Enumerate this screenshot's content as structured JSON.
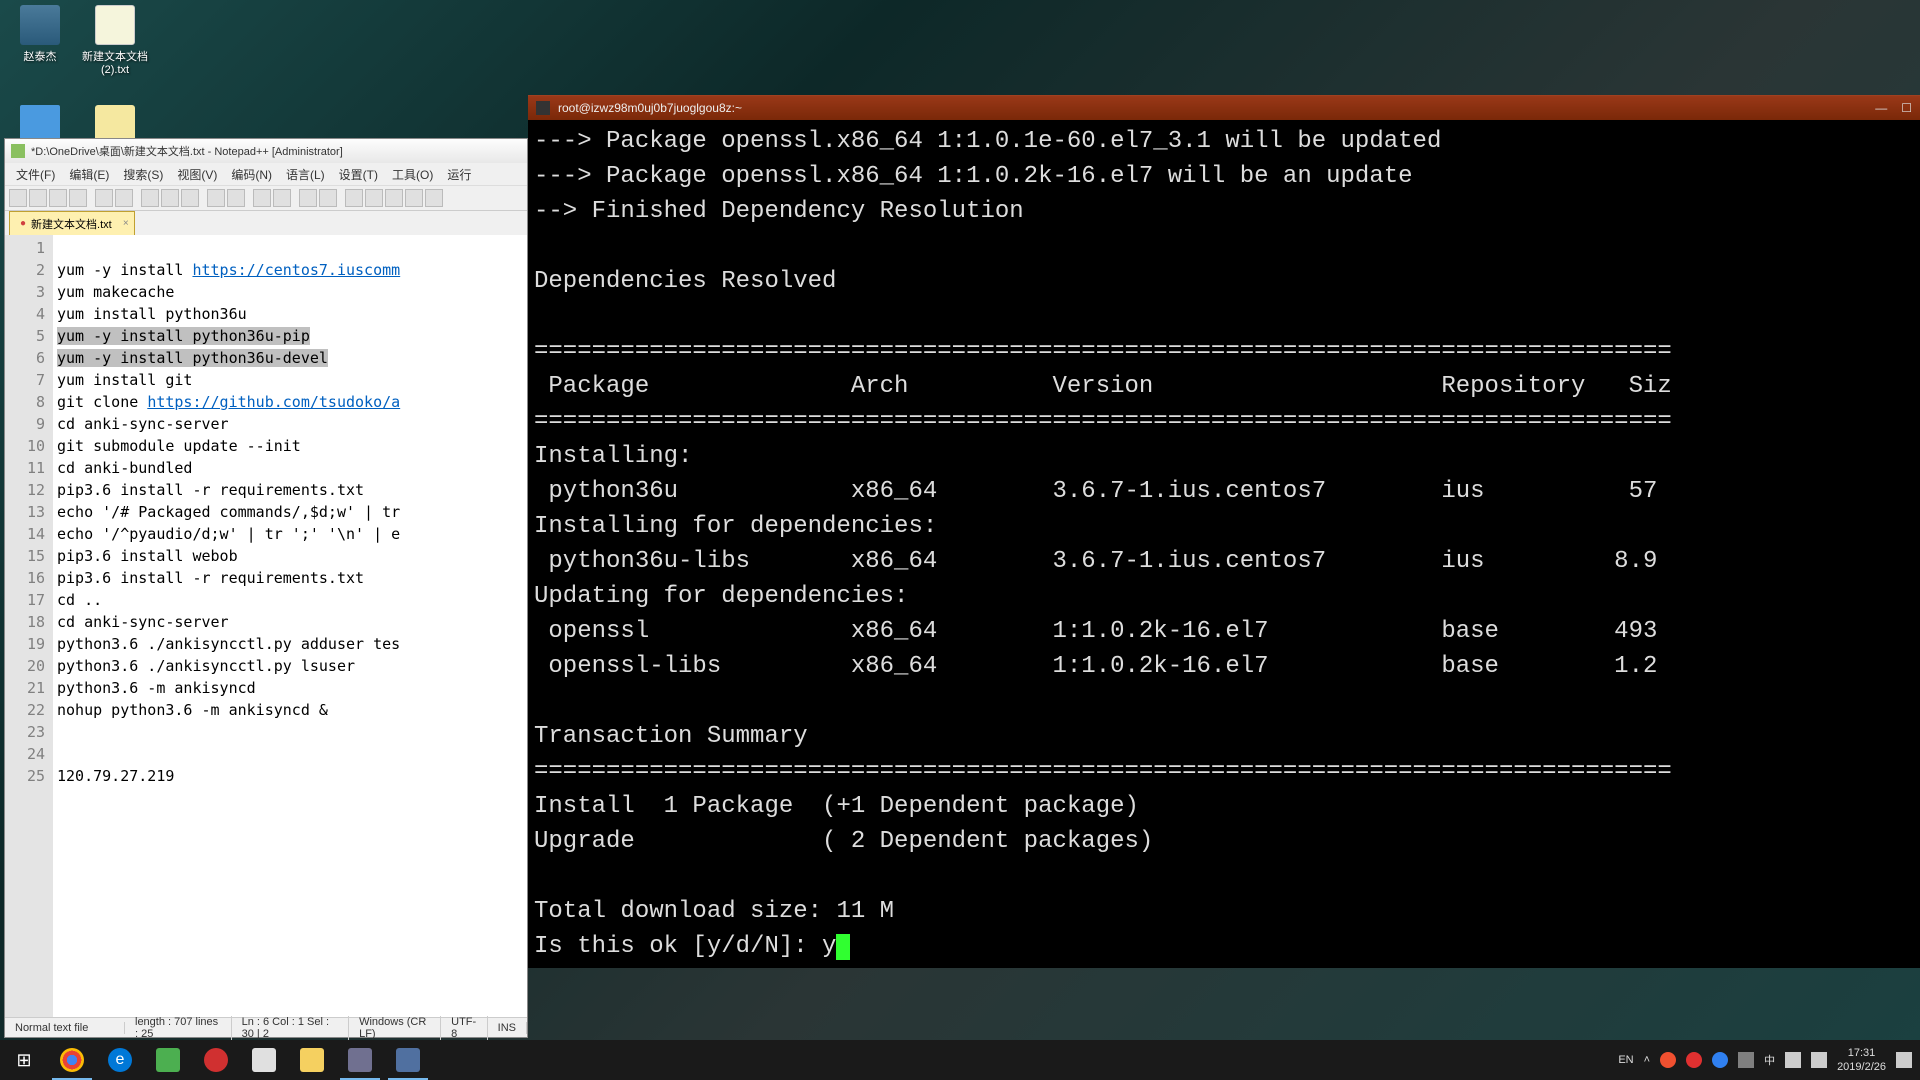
{
  "desktop": {
    "icons": [
      {
        "label": "赵泰杰"
      },
      {
        "label": "新建文本文档 (2).txt"
      },
      {
        "label": ""
      },
      {
        "label": ""
      }
    ]
  },
  "notepadpp": {
    "title": "*D:\\OneDrive\\桌面\\新建文本文档.txt - Notepad++ [Administrator]",
    "menu": [
      "文件(F)",
      "编辑(E)",
      "搜索(S)",
      "视图(V)",
      "编码(N)",
      "语言(L)",
      "设置(T)",
      "工具(O)",
      "运行"
    ],
    "tab": "新建文本文档.txt",
    "lines": [
      "",
      "yum -y install https://centos7.iuscomm",
      "yum makecache",
      "yum install python36u",
      "yum -y install python36u-pip",
      "yum -y install python36u-devel",
      "yum install git",
      "git clone https://github.com/tsudoko/a",
      "cd anki-sync-server",
      "git submodule update --init",
      "cd anki-bundled",
      "pip3.6 install -r requirements.txt",
      "echo '/# Packaged commands/,$d;w' | tr",
      "echo '/^pyaudio/d;w' | tr ';' '\\n' | e",
      "pip3.6 install webob",
      "pip3.6 install -r requirements.txt",
      "cd ..",
      "cd anki-sync-server",
      "python3.6 ./ankisyncctl.py adduser tes",
      "python3.6 ./ankisyncctl.py lsuser",
      "python3.6 -m ankisyncd",
      "nohup python3.6 -m ankisyncd &",
      "",
      "",
      "120.79.27.219"
    ],
    "status": {
      "type": "Normal text file",
      "length": "length : 707    lines : 25",
      "pos": "Ln : 6    Col : 1    Sel : 30 | 2",
      "eol": "Windows (CR LF)",
      "enc": "UTF-8",
      "ins": "INS"
    }
  },
  "terminal": {
    "title": "root@izwz98m0uj0b7juoglgou8z:~",
    "lines": [
      "---> Package openssl.x86_64 1:1.0.1e-60.el7_3.1 will be updated",
      "---> Package openssl.x86_64 1:1.0.2k-16.el7 will be an update",
      "--> Finished Dependency Resolution",
      "",
      "Dependencies Resolved",
      "",
      "===============================================================================",
      " Package              Arch          Version                    Repository   Siz",
      "===============================================================================",
      "Installing:",
      " python36u            x86_64        3.6.7-1.ius.centos7        ius          57",
      "Installing for dependencies:",
      " python36u-libs       x86_64        3.6.7-1.ius.centos7        ius         8.9",
      "Updating for dependencies:",
      " openssl              x86_64        1:1.0.2k-16.el7            base        493",
      " openssl-libs         x86_64        1:1.0.2k-16.el7            base        1.2",
      "",
      "Transaction Summary",
      "===============================================================================",
      "Install  1 Package  (+1 Dependent package)",
      "Upgrade             ( 2 Dependent packages)",
      "",
      "Total download size: 11 M",
      "Is this ok [y/d/N]: y"
    ]
  },
  "taskbar": {
    "lang": "EN",
    "ime": "中",
    "time": "17:31",
    "date": "2019/2/26"
  }
}
